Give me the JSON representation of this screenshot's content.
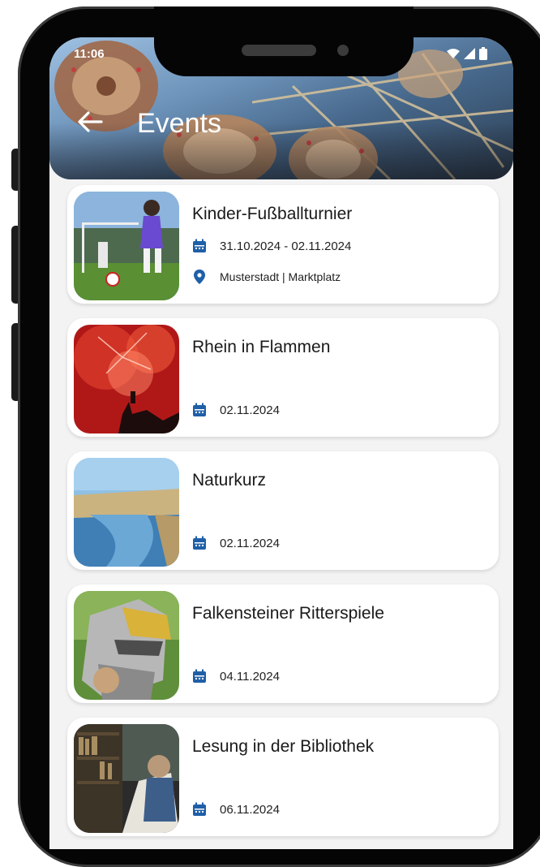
{
  "status_bar": {
    "time": "11:06"
  },
  "header": {
    "title": "Events",
    "back_icon": "arrow-left-icon"
  },
  "colors": {
    "accent": "#1f5fa8",
    "card_bg": "#ffffff",
    "screen_bg": "#f3f3f4"
  },
  "events": [
    {
      "title": "Kinder-Fußballturnier",
      "date": "31.10.2024 - 02.11.2024",
      "location": "Musterstadt | Marktplatz"
    },
    {
      "title": "Rhein in Flammen",
      "date": "02.11.2024"
    },
    {
      "title": "Naturkurz",
      "date": "02.11.2024"
    },
    {
      "title": "Falkensteiner Ritterspiele",
      "date": "04.11.2024"
    },
    {
      "title": "Lesung in der Bibliothek",
      "date": "06.11.2024"
    }
  ]
}
